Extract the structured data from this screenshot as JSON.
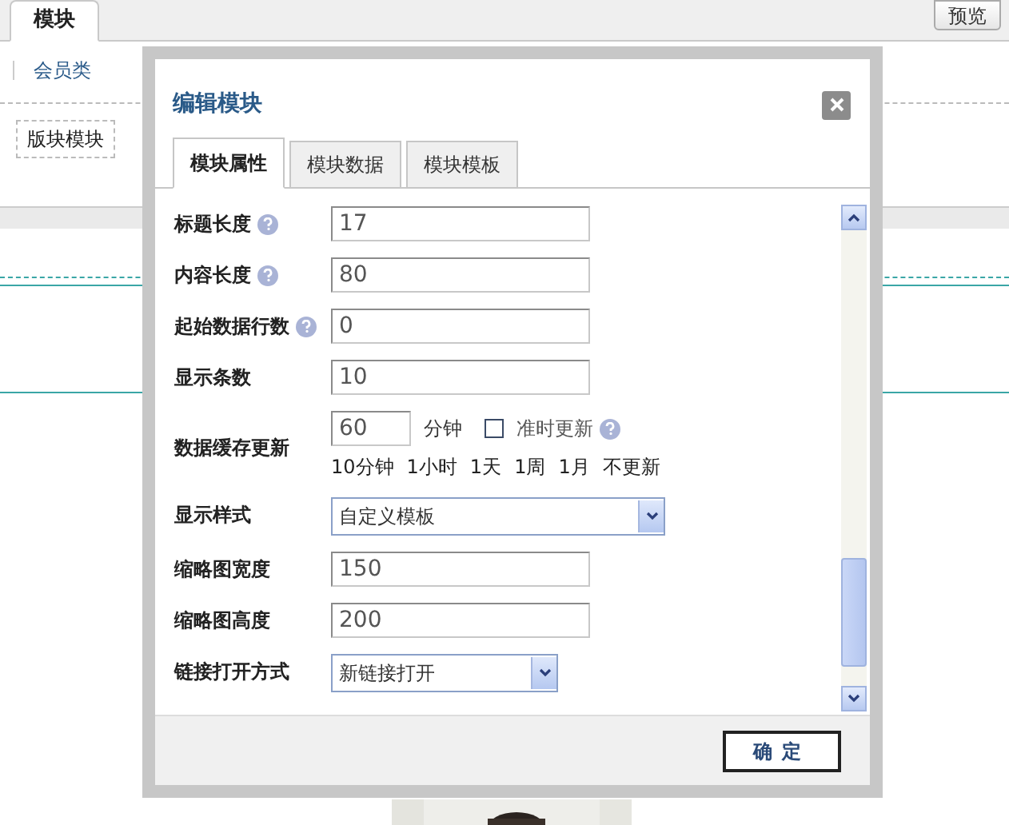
{
  "page": {
    "tab": "模块",
    "preview_button": "预览",
    "links": [
      "会员类"
    ],
    "modules": [
      "版块模块"
    ]
  },
  "dialog": {
    "title": "编辑模块",
    "tabs": [
      {
        "label": "模块属性",
        "selected": true
      },
      {
        "label": "模块数据",
        "selected": false
      },
      {
        "label": "模块模板",
        "selected": false
      }
    ],
    "fields": [
      {
        "kind": "text",
        "label": "标题长度",
        "help": true,
        "value": "17"
      },
      {
        "kind": "text",
        "label": "内容长度",
        "help": true,
        "value": "80"
      },
      {
        "kind": "text",
        "label": "起始数据行数",
        "help": true,
        "value": "0"
      },
      {
        "kind": "text",
        "label": "显示条数",
        "help": false,
        "value": "10"
      },
      {
        "kind": "cache",
        "label": "数据缓存更新",
        "help": false,
        "value": "60",
        "unit": "分钟",
        "checkbox": {
          "label": "准时更新",
          "checked": false,
          "help": true
        },
        "presets": [
          "10分钟",
          "1小时",
          "1天",
          "1周",
          "1月",
          "不更新"
        ]
      },
      {
        "kind": "select",
        "label": "显示样式",
        "help": false,
        "value": "自定义模板",
        "wide": true
      },
      {
        "kind": "text",
        "label": "缩略图宽度",
        "help": false,
        "value": "150"
      },
      {
        "kind": "text",
        "label": "缩略图高度",
        "help": false,
        "value": "200"
      },
      {
        "kind": "select",
        "label": "链接打开方式",
        "help": false,
        "value": "新链接打开",
        "wide": false
      }
    ],
    "ok_button": "确定"
  }
}
